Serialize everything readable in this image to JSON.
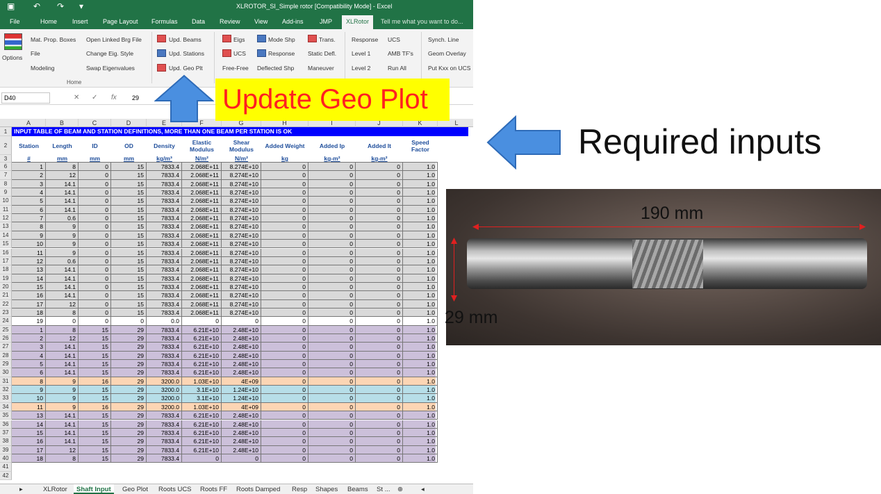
{
  "window": {
    "title": "XLROTOR_SI_Simple rotor  [Compatibility Mode] - Excel"
  },
  "ribbon_tabs": [
    "File",
    "Home",
    "Insert",
    "Page Layout",
    "Formulas",
    "Data",
    "Review",
    "View",
    "Add-ins",
    "JMP",
    "XLRotor"
  ],
  "tell_me": "Tell me what you want to do...",
  "ribbon": {
    "options": "Options",
    "col1": [
      "Mat. Prop. Boxes",
      "File",
      "Modeling"
    ],
    "col2": [
      "Open Linked Brg File",
      "Change Eig. Style",
      "Swap Eigenvalues"
    ],
    "col3": [
      "Upd. Beams",
      "Upd. Stations",
      "Upd. Geo Plt"
    ],
    "col4": [
      "Eigs",
      "UCS",
      "Free-Free"
    ],
    "col5": [
      "Mode Shp",
      "Response",
      "Deflected Shp"
    ],
    "col6": [
      "Trans.",
      "Static Defl.",
      "Maneuver"
    ],
    "col7": [
      "Response",
      "Level 1",
      "Level 2"
    ],
    "col8": [
      "UCS",
      "AMB TF's",
      "Run All"
    ],
    "col9": [
      "Synch. Line",
      "Geom Overlay",
      "Put Kxx on UCS"
    ],
    "group_label": "Home"
  },
  "formula": {
    "namebox": "D40",
    "value": "29"
  },
  "columns": [
    "A",
    "B",
    "C",
    "D",
    "E",
    "F",
    "G",
    "H",
    "I",
    "J",
    "K",
    "L"
  ],
  "sheet": {
    "banner": "INPUT TABLE OF BEAM AND STATION DEFINITIONS, MORE THAN ONE BEAM PER STATION IS OK",
    "headers": [
      "Station",
      "Length",
      "ID",
      "OD",
      "Density",
      "Elastic Modulus",
      "Shear Modulus",
      "Added Weight",
      "Added Ip",
      "Added It",
      "Speed Factor"
    ],
    "units": [
      "#",
      "mm",
      "mm",
      "mm",
      "kg/m³",
      "N/m²",
      "N/m²",
      "kg",
      "kg-m²",
      "kg-m²",
      ""
    ],
    "rows": [
      [
        "6",
        "1",
        "8",
        "0",
        "15",
        "7833.4",
        "2.068E+11",
        "8.274E+10",
        "0",
        "0",
        "0",
        "1.0"
      ],
      [
        "7",
        "2",
        "12",
        "0",
        "15",
        "7833.4",
        "2.068E+11",
        "8.274E+10",
        "0",
        "0",
        "0",
        "1.0"
      ],
      [
        "8",
        "3",
        "14.1",
        "0",
        "15",
        "7833.4",
        "2.068E+11",
        "8.274E+10",
        "0",
        "0",
        "0",
        "1.0"
      ],
      [
        "9",
        "4",
        "14.1",
        "0",
        "15",
        "7833.4",
        "2.068E+11",
        "8.274E+10",
        "0",
        "0",
        "0",
        "1.0"
      ],
      [
        "10",
        "5",
        "14.1",
        "0",
        "15",
        "7833.4",
        "2.068E+11",
        "8.274E+10",
        "0",
        "0",
        "0",
        "1.0"
      ],
      [
        "11",
        "6",
        "14.1",
        "0",
        "15",
        "7833.4",
        "2.068E+11",
        "8.274E+10",
        "0",
        "0",
        "0",
        "1.0"
      ],
      [
        "12",
        "7",
        "0.6",
        "0",
        "15",
        "7833.4",
        "2.068E+11",
        "8.274E+10",
        "0",
        "0",
        "0",
        "1.0"
      ],
      [
        "13",
        "8",
        "9",
        "0",
        "15",
        "7833.4",
        "2.068E+11",
        "8.274E+10",
        "0",
        "0",
        "0",
        "1.0"
      ],
      [
        "14",
        "9",
        "9",
        "0",
        "15",
        "7833.4",
        "2.068E+11",
        "8.274E+10",
        "0",
        "0",
        "0",
        "1.0"
      ],
      [
        "15",
        "10",
        "9",
        "0",
        "15",
        "7833.4",
        "2.068E+11",
        "8.274E+10",
        "0",
        "0",
        "0",
        "1.0"
      ],
      [
        "16",
        "11",
        "9",
        "0",
        "15",
        "7833.4",
        "2.068E+11",
        "8.274E+10",
        "0",
        "0",
        "0",
        "1.0"
      ],
      [
        "17",
        "12",
        "0.6",
        "0",
        "15",
        "7833.4",
        "2.068E+11",
        "8.274E+10",
        "0",
        "0",
        "0",
        "1.0"
      ],
      [
        "18",
        "13",
        "14.1",
        "0",
        "15",
        "7833.4",
        "2.068E+11",
        "8.274E+10",
        "0",
        "0",
        "0",
        "1.0"
      ],
      [
        "19",
        "14",
        "14.1",
        "0",
        "15",
        "7833.4",
        "2.068E+11",
        "8.274E+10",
        "0",
        "0",
        "0",
        "1.0"
      ],
      [
        "20",
        "15",
        "14.1",
        "0",
        "15",
        "7833.4",
        "2.068E+11",
        "8.274E+10",
        "0",
        "0",
        "0",
        "1.0"
      ],
      [
        "21",
        "16",
        "14.1",
        "0",
        "15",
        "7833.4",
        "2.068E+11",
        "8.274E+10",
        "0",
        "0",
        "0",
        "1.0"
      ],
      [
        "22",
        "17",
        "12",
        "0",
        "15",
        "7833.4",
        "2.068E+11",
        "8.274E+10",
        "0",
        "0",
        "0",
        "1.0"
      ],
      [
        "23",
        "18",
        "8",
        "0",
        "15",
        "7833.4",
        "2.068E+11",
        "8.274E+10",
        "0",
        "0",
        "0",
        "1.0"
      ],
      [
        "24",
        "19",
        "0",
        "0",
        "0",
        "0.0",
        "0",
        "0",
        "0",
        "0",
        "0",
        "1.0"
      ],
      [
        "25",
        "1",
        "8",
        "15",
        "29",
        "7833.4",
        "6.21E+10",
        "2.48E+10",
        "0",
        "0",
        "0",
        "1.0"
      ],
      [
        "26",
        "2",
        "12",
        "15",
        "29",
        "7833.4",
        "6.21E+10",
        "2.48E+10",
        "0",
        "0",
        "0",
        "1.0"
      ],
      [
        "27",
        "3",
        "14.1",
        "15",
        "29",
        "7833.4",
        "6.21E+10",
        "2.48E+10",
        "0",
        "0",
        "0",
        "1.0"
      ],
      [
        "28",
        "4",
        "14.1",
        "15",
        "29",
        "7833.4",
        "6.21E+10",
        "2.48E+10",
        "0",
        "0",
        "0",
        "1.0"
      ],
      [
        "29",
        "5",
        "14.1",
        "15",
        "29",
        "7833.4",
        "6.21E+10",
        "2.48E+10",
        "0",
        "0",
        "0",
        "1.0"
      ],
      [
        "30",
        "6",
        "14.1",
        "15",
        "29",
        "7833.4",
        "6.21E+10",
        "2.48E+10",
        "0",
        "0",
        "0",
        "1.0"
      ],
      [
        "31",
        "8",
        "9",
        "16",
        "29",
        "3200.0",
        "1.03E+10",
        "4E+09",
        "0",
        "0",
        "0",
        "1.0"
      ],
      [
        "32",
        "9",
        "9",
        "15",
        "29",
        "3200.0",
        "3.1E+10",
        "1.24E+10",
        "0",
        "0",
        "0",
        "1.0"
      ],
      [
        "33",
        "10",
        "9",
        "15",
        "29",
        "3200.0",
        "3.1E+10",
        "1.24E+10",
        "0",
        "0",
        "0",
        "1.0"
      ],
      [
        "34",
        "11",
        "9",
        "16",
        "29",
        "3200.0",
        "1.03E+10",
        "4E+09",
        "0",
        "0",
        "0",
        "1.0"
      ],
      [
        "35",
        "13",
        "14.1",
        "15",
        "29",
        "7833.4",
        "6.21E+10",
        "2.48E+10",
        "0",
        "0",
        "0",
        "1.0"
      ],
      [
        "36",
        "14",
        "14.1",
        "15",
        "29",
        "7833.4",
        "6.21E+10",
        "2.48E+10",
        "0",
        "0",
        "0",
        "1.0"
      ],
      [
        "37",
        "15",
        "14.1",
        "15",
        "29",
        "7833.4",
        "6.21E+10",
        "2.48E+10",
        "0",
        "0",
        "0",
        "1.0"
      ],
      [
        "38",
        "16",
        "14.1",
        "15",
        "29",
        "7833.4",
        "6.21E+10",
        "2.48E+10",
        "0",
        "0",
        "0",
        "1.0"
      ],
      [
        "39",
        "17",
        "12",
        "15",
        "29",
        "7833.4",
        "6.21E+10",
        "2.48E+10",
        "0",
        "0",
        "0",
        "1.0"
      ],
      [
        "40",
        "18",
        "8",
        "15",
        "29",
        "7833.4",
        "0",
        "0",
        "0",
        "0",
        "0",
        "1.0"
      ]
    ],
    "empty_rows": [
      "41",
      "42"
    ],
    "row_colors": {
      "white": "#ffffff",
      "gray": "#d9d9d9",
      "purple": "#ccc0da",
      "orange": "#fcd5b4",
      "blue": "#b7dee8",
      "banner": "#0000ff"
    }
  },
  "sheet_tabs": [
    "XLRotor",
    "Shaft Input",
    "Geo Plot",
    "Roots UCS",
    "Roots FF",
    "Roots Damped",
    "Resp",
    "Shapes",
    "Beams",
    "St ..."
  ],
  "callouts": {
    "update": "Update Geo Plot",
    "required": "Required inputs",
    "dim_length": "190 mm",
    "dim_diameter": "29 mm"
  },
  "colors": {
    "excel_green": "#217346",
    "callout_yellow": "#ffff00",
    "callout_red": "#ff2020",
    "arrow_blue": "#4a8fe0"
  }
}
